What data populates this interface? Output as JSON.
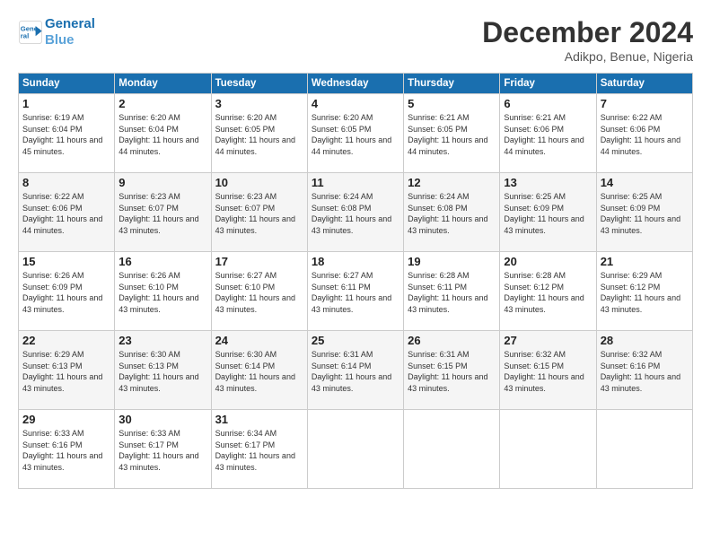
{
  "header": {
    "logo_line1": "General",
    "logo_line2": "Blue",
    "month": "December 2024",
    "location": "Adikpo, Benue, Nigeria"
  },
  "weekdays": [
    "Sunday",
    "Monday",
    "Tuesday",
    "Wednesday",
    "Thursday",
    "Friday",
    "Saturday"
  ],
  "weeks": [
    [
      {
        "day": "1",
        "sunrise": "Sunrise: 6:19 AM",
        "sunset": "Sunset: 6:04 PM",
        "daylight": "Daylight: 11 hours and 45 minutes."
      },
      {
        "day": "2",
        "sunrise": "Sunrise: 6:20 AM",
        "sunset": "Sunset: 6:04 PM",
        "daylight": "Daylight: 11 hours and 44 minutes."
      },
      {
        "day": "3",
        "sunrise": "Sunrise: 6:20 AM",
        "sunset": "Sunset: 6:05 PM",
        "daylight": "Daylight: 11 hours and 44 minutes."
      },
      {
        "day": "4",
        "sunrise": "Sunrise: 6:20 AM",
        "sunset": "Sunset: 6:05 PM",
        "daylight": "Daylight: 11 hours and 44 minutes."
      },
      {
        "day": "5",
        "sunrise": "Sunrise: 6:21 AM",
        "sunset": "Sunset: 6:05 PM",
        "daylight": "Daylight: 11 hours and 44 minutes."
      },
      {
        "day": "6",
        "sunrise": "Sunrise: 6:21 AM",
        "sunset": "Sunset: 6:06 PM",
        "daylight": "Daylight: 11 hours and 44 minutes."
      },
      {
        "day": "7",
        "sunrise": "Sunrise: 6:22 AM",
        "sunset": "Sunset: 6:06 PM",
        "daylight": "Daylight: 11 hours and 44 minutes."
      }
    ],
    [
      {
        "day": "8",
        "sunrise": "Sunrise: 6:22 AM",
        "sunset": "Sunset: 6:06 PM",
        "daylight": "Daylight: 11 hours and 44 minutes."
      },
      {
        "day": "9",
        "sunrise": "Sunrise: 6:23 AM",
        "sunset": "Sunset: 6:07 PM",
        "daylight": "Daylight: 11 hours and 43 minutes."
      },
      {
        "day": "10",
        "sunrise": "Sunrise: 6:23 AM",
        "sunset": "Sunset: 6:07 PM",
        "daylight": "Daylight: 11 hours and 43 minutes."
      },
      {
        "day": "11",
        "sunrise": "Sunrise: 6:24 AM",
        "sunset": "Sunset: 6:08 PM",
        "daylight": "Daylight: 11 hours and 43 minutes."
      },
      {
        "day": "12",
        "sunrise": "Sunrise: 6:24 AM",
        "sunset": "Sunset: 6:08 PM",
        "daylight": "Daylight: 11 hours and 43 minutes."
      },
      {
        "day": "13",
        "sunrise": "Sunrise: 6:25 AM",
        "sunset": "Sunset: 6:09 PM",
        "daylight": "Daylight: 11 hours and 43 minutes."
      },
      {
        "day": "14",
        "sunrise": "Sunrise: 6:25 AM",
        "sunset": "Sunset: 6:09 PM",
        "daylight": "Daylight: 11 hours and 43 minutes."
      }
    ],
    [
      {
        "day": "15",
        "sunrise": "Sunrise: 6:26 AM",
        "sunset": "Sunset: 6:09 PM",
        "daylight": "Daylight: 11 hours and 43 minutes."
      },
      {
        "day": "16",
        "sunrise": "Sunrise: 6:26 AM",
        "sunset": "Sunset: 6:10 PM",
        "daylight": "Daylight: 11 hours and 43 minutes."
      },
      {
        "day": "17",
        "sunrise": "Sunrise: 6:27 AM",
        "sunset": "Sunset: 6:10 PM",
        "daylight": "Daylight: 11 hours and 43 minutes."
      },
      {
        "day": "18",
        "sunrise": "Sunrise: 6:27 AM",
        "sunset": "Sunset: 6:11 PM",
        "daylight": "Daylight: 11 hours and 43 minutes."
      },
      {
        "day": "19",
        "sunrise": "Sunrise: 6:28 AM",
        "sunset": "Sunset: 6:11 PM",
        "daylight": "Daylight: 11 hours and 43 minutes."
      },
      {
        "day": "20",
        "sunrise": "Sunrise: 6:28 AM",
        "sunset": "Sunset: 6:12 PM",
        "daylight": "Daylight: 11 hours and 43 minutes."
      },
      {
        "day": "21",
        "sunrise": "Sunrise: 6:29 AM",
        "sunset": "Sunset: 6:12 PM",
        "daylight": "Daylight: 11 hours and 43 minutes."
      }
    ],
    [
      {
        "day": "22",
        "sunrise": "Sunrise: 6:29 AM",
        "sunset": "Sunset: 6:13 PM",
        "daylight": "Daylight: 11 hours and 43 minutes."
      },
      {
        "day": "23",
        "sunrise": "Sunrise: 6:30 AM",
        "sunset": "Sunset: 6:13 PM",
        "daylight": "Daylight: 11 hours and 43 minutes."
      },
      {
        "day": "24",
        "sunrise": "Sunrise: 6:30 AM",
        "sunset": "Sunset: 6:14 PM",
        "daylight": "Daylight: 11 hours and 43 minutes."
      },
      {
        "day": "25",
        "sunrise": "Sunrise: 6:31 AM",
        "sunset": "Sunset: 6:14 PM",
        "daylight": "Daylight: 11 hours and 43 minutes."
      },
      {
        "day": "26",
        "sunrise": "Sunrise: 6:31 AM",
        "sunset": "Sunset: 6:15 PM",
        "daylight": "Daylight: 11 hours and 43 minutes."
      },
      {
        "day": "27",
        "sunrise": "Sunrise: 6:32 AM",
        "sunset": "Sunset: 6:15 PM",
        "daylight": "Daylight: 11 hours and 43 minutes."
      },
      {
        "day": "28",
        "sunrise": "Sunrise: 6:32 AM",
        "sunset": "Sunset: 6:16 PM",
        "daylight": "Daylight: 11 hours and 43 minutes."
      }
    ],
    [
      {
        "day": "29",
        "sunrise": "Sunrise: 6:33 AM",
        "sunset": "Sunset: 6:16 PM",
        "daylight": "Daylight: 11 hours and 43 minutes."
      },
      {
        "day": "30",
        "sunrise": "Sunrise: 6:33 AM",
        "sunset": "Sunset: 6:17 PM",
        "daylight": "Daylight: 11 hours and 43 minutes."
      },
      {
        "day": "31",
        "sunrise": "Sunrise: 6:34 AM",
        "sunset": "Sunset: 6:17 PM",
        "daylight": "Daylight: 11 hours and 43 minutes."
      },
      null,
      null,
      null,
      null
    ]
  ]
}
